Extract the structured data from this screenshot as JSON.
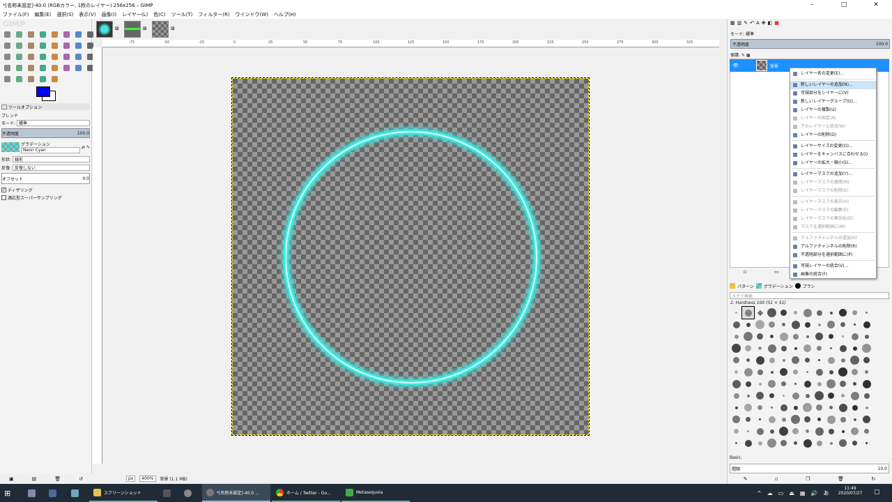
{
  "window": {
    "title": "*[名称未設定]-40.0 (RGBカラー, 1枚のレイヤー) 256x256 – GIMP"
  },
  "menu": [
    "ファイル(F)",
    "編集(E)",
    "選択(S)",
    "表示(V)",
    "画像(I)",
    "レイヤー(L)",
    "色(C)",
    "ツール(T)",
    "フィルター(R)",
    "ウインドウ(W)",
    "ヘルプ(H)"
  ],
  "tool_options": {
    "header": "ツールオプション",
    "tool_name": "ブレンド",
    "mode_label": "モード:",
    "mode_value": "標準",
    "opacity_label": "不透明度",
    "opacity_value": "100.0",
    "gradient_label": "グラデーション",
    "gradient_value": "Neon Cyan",
    "shape_label": "形状:",
    "shape_value": "線形",
    "repeat_label": "反復:",
    "repeat_value": "反復しない",
    "offset_label": "オフセット",
    "offset_value": "0.0",
    "dither_label": "ディザリング",
    "adaptive_label": "適応型スーパーサンプリング"
  },
  "status": {
    "unit": "px",
    "zoom": "400%",
    "layer_info": "背景 (1.1 MB)"
  },
  "ruler_ticks": [
    "-75",
    "-50",
    "-25",
    "0",
    "25",
    "50",
    "75",
    "100",
    "125",
    "150",
    "175",
    "200",
    "225",
    "250",
    "275",
    "300",
    "325"
  ],
  "layers_panel": {
    "mode_label": "モード:",
    "mode_value": "標準",
    "opacity_label": "不透明度",
    "opacity_value": "100.0",
    "lock_label": "保護:",
    "layer_name": "背景"
  },
  "context_menu": [
    {
      "label": "レイヤー名の変更(E)...",
      "enabled": true
    },
    {
      "sep": true
    },
    {
      "label": "新しいレイヤーの追加(N)...",
      "enabled": true,
      "highlight": true
    },
    {
      "label": "可視部分をレイヤーに(V)",
      "enabled": true
    },
    {
      "label": "新しいレイヤーグループ(G)...",
      "enabled": true
    },
    {
      "label": "レイヤーの複製(U)",
      "enabled": true
    },
    {
      "label": "レイヤーの固定(A)",
      "enabled": false
    },
    {
      "label": "下のレイヤーと統合(W)",
      "enabled": false
    },
    {
      "label": "レイヤーの削除(D)",
      "enabled": true
    },
    {
      "sep": true
    },
    {
      "label": "レイヤーサイズの変更(O)...",
      "enabled": true
    },
    {
      "label": "レイヤーをキャンバスに合わせる(I)",
      "enabled": true
    },
    {
      "label": "レイヤーの拡大・縮小(S)...",
      "enabled": true
    },
    {
      "sep": true
    },
    {
      "label": "レイヤーマスクの追加(Y)...",
      "enabled": true
    },
    {
      "label": "レイヤーマスクの適用(M)",
      "enabled": false
    },
    {
      "label": "レイヤーマスクの削除(K)",
      "enabled": false
    },
    {
      "sep": true
    },
    {
      "label": "レイヤーマスクの表示(H)",
      "enabled": false
    },
    {
      "label": "レイヤーマスクの編集(E)",
      "enabled": false
    },
    {
      "label": "レイヤーマスクの無効化(D)",
      "enabled": false
    },
    {
      "label": "マスクを選択範囲に(M)",
      "enabled": false
    },
    {
      "sep": true
    },
    {
      "label": "アルファチャンネルの追加(H)",
      "enabled": false
    },
    {
      "label": "アルファチャンネルの削除(R)",
      "enabled": true
    },
    {
      "label": "不透明部分を選択範囲に(P)",
      "enabled": true
    },
    {
      "sep": true
    },
    {
      "label": "可視レイヤーの統合(V)...",
      "enabled": true
    },
    {
      "label": "画像の統合(F)",
      "enabled": true
    }
  ],
  "brushes_panel": {
    "tabs": [
      "パターン",
      "グラデーション",
      "ブラシ"
    ],
    "filter_placeholder": "タグで検索",
    "brush_name": "2. Hardness 100 (51 × 51)",
    "preset": "Basic,",
    "spacing_label": "間隔",
    "spacing_value": "10.0"
  },
  "taskbar": {
    "items": [
      "スクリーンショット",
      "*[名称未設定]-40.0 ...",
      "ホーム / Twitter - Go...",
      "Metasequoia"
    ],
    "time": "11:49",
    "date": "2020/07/27"
  },
  "colors": {
    "fg": "#0000ff",
    "bg": "#ffffff",
    "ring": "#3fe8e0",
    "accent": "#1e90ff"
  }
}
